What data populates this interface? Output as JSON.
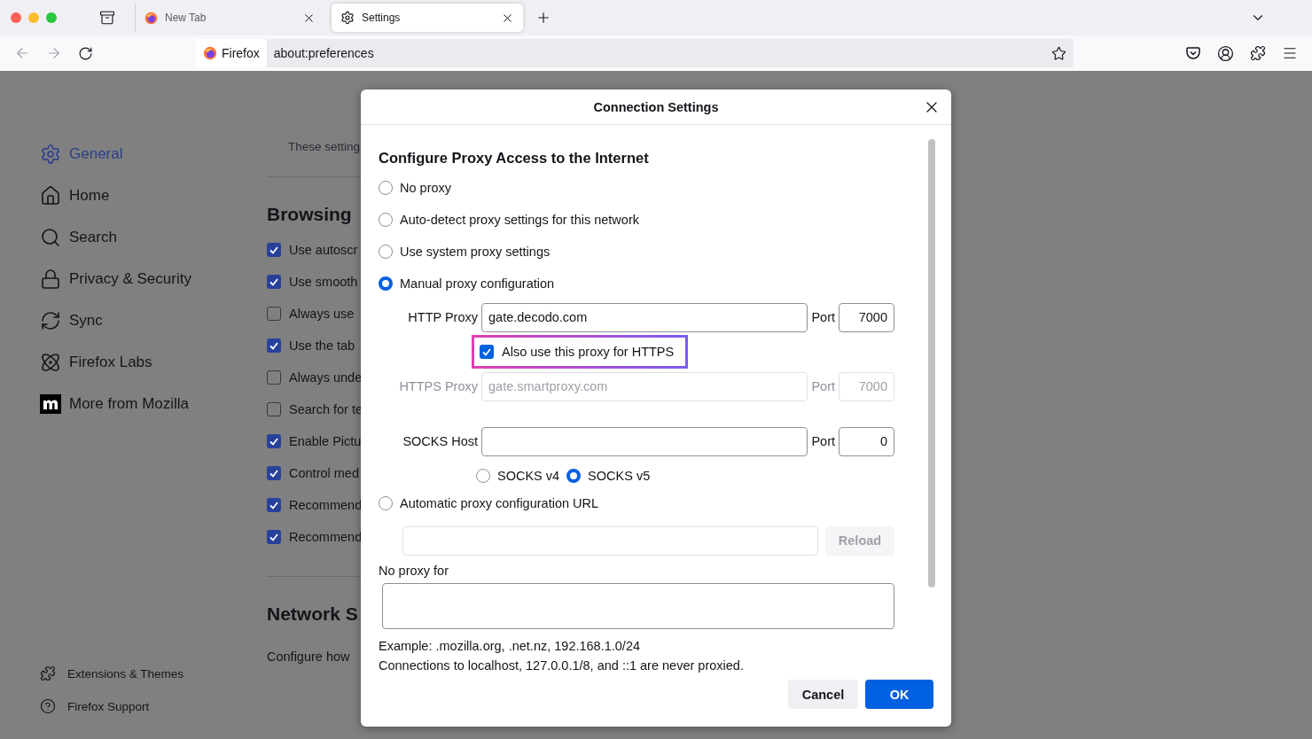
{
  "browser": {
    "tabs": [
      {
        "title": "New Tab",
        "kind": "firefox",
        "selected": false
      },
      {
        "title": "Settings",
        "kind": "gear",
        "selected": true
      }
    ],
    "identity_label": "Firefox",
    "url": "about:preferences"
  },
  "sidebar": {
    "items": [
      {
        "label": "General",
        "kind": "gear",
        "selected": true
      },
      {
        "label": "Home",
        "kind": "home",
        "selected": false
      },
      {
        "label": "Search",
        "kind": "search",
        "selected": false
      },
      {
        "label": "Privacy & Security",
        "kind": "lock",
        "selected": false
      },
      {
        "label": "Sync",
        "kind": "sync",
        "selected": false
      },
      {
        "label": "Firefox Labs",
        "kind": "atom",
        "selected": false
      },
      {
        "label": "More from Mozilla",
        "kind": "mozilla",
        "selected": false
      }
    ],
    "footer_items": [
      {
        "label": "Extensions & Themes",
        "kind": "puzzle"
      },
      {
        "label": "Firefox Support",
        "kind": "help"
      }
    ]
  },
  "page": {
    "intro": "These setting",
    "sections": [
      {
        "heading": "Browsing",
        "options": [
          {
            "label": "Use autoscr",
            "checked": true
          },
          {
            "label": "Use smooth",
            "checked": true
          },
          {
            "label": "Always use",
            "checked": false
          },
          {
            "label": "Use the tab",
            "checked": true
          },
          {
            "label": "Always unde",
            "checked": false
          },
          {
            "label": "Search for te",
            "checked": false
          },
          {
            "label": "Enable Pictu",
            "checked": true
          },
          {
            "label": "Control med",
            "checked": true
          },
          {
            "label": "Recommend",
            "checked": true
          },
          {
            "label": "Recommend",
            "checked": true
          }
        ]
      },
      {
        "heading": "Network S",
        "description": "Configure how"
      }
    ]
  },
  "dialog": {
    "title": "Connection Settings",
    "heading": "Configure Proxy Access to the Internet",
    "proxy_modes": [
      {
        "label": "No proxy",
        "kind": "simple",
        "selected": false
      },
      {
        "label": "Auto-detect proxy settings for this network",
        "kind": "simple",
        "selected": false
      },
      {
        "label": "Use system proxy settings",
        "kind": "simple",
        "selected": false
      },
      {
        "label": "Manual proxy configuration",
        "kind": "manual",
        "selected": true
      },
      {
        "label": "Automatic proxy configuration URL",
        "kind": "url",
        "selected": false
      }
    ],
    "manual": {
      "http": {
        "label": "HTTP Proxy",
        "value": "gate.decodo.com",
        "port_label": "Port",
        "port": "7000",
        "disabled": false
      },
      "also_https": {
        "label": "Also use this proxy for HTTPS",
        "checked": true,
        "highlighted": true
      },
      "https": {
        "label": "HTTPS Proxy",
        "value": "gate.smartproxy.com",
        "port_label": "Port",
        "port": "7000",
        "disabled": true
      },
      "socks": {
        "label": "SOCKS Host",
        "port_label": "Port",
        "port": "0",
        "disabled": false
      },
      "socks_versions": [
        {
          "label": "SOCKS v4",
          "selected": false
        },
        {
          "label": "SOCKS v5",
          "selected": true
        }
      ]
    },
    "reload_label": "Reload",
    "reload_disabled": true,
    "no_proxy_label": "No proxy for",
    "notes": [
      "Example: .mozilla.org, .net.nz, 192.168.1.0/24",
      "Connections to localhost, 127.0.0.1/8, and ::1 are never proxied."
    ],
    "buttons": [
      {
        "label": "Cancel",
        "kind": "secondary"
      },
      {
        "label": "OK",
        "kind": "primary"
      }
    ]
  }
}
